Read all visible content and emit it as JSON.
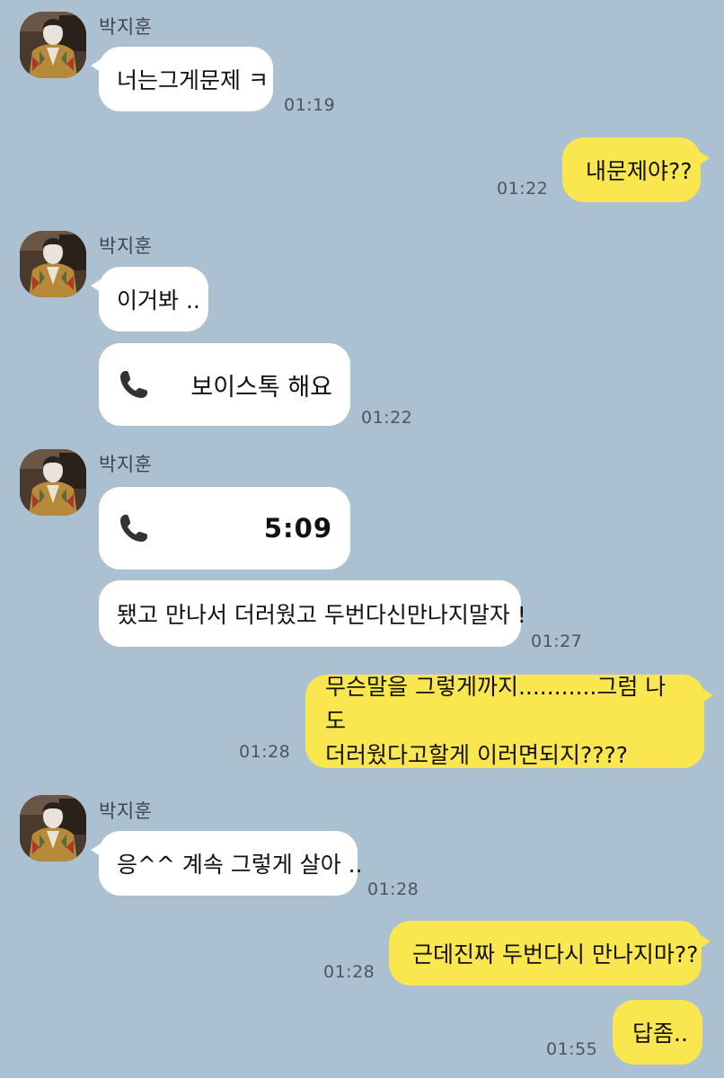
{
  "sender_name": "박지훈",
  "messages": [
    {
      "text": "너는그게문제 ㅋ",
      "time": "01:19"
    },
    {
      "text": "내문제야??",
      "time": "01:22"
    },
    {
      "text": "이거봐 ..",
      "time": ""
    },
    {
      "call_label": "보이스톡 해요",
      "time": "01:22"
    },
    {
      "call_label": "5:09",
      "time": ""
    },
    {
      "text": "됐고 만나서 더러웠고 두번다신만나지말자 !",
      "time": "01:27"
    },
    {
      "line1": "무슨말을 그렇게까지...........그럼 나도",
      "line2": "더러웠다고할게 이러면되지????",
      "time": "01:28"
    },
    {
      "text": "응^^ 계속 그렇게 살아 ..",
      "time": "01:28"
    },
    {
      "text": "근데진짜 두번다시 만나지마??",
      "time": "01:28"
    },
    {
      "text": "답좀..",
      "time": "01:55"
    }
  ],
  "colors": {
    "background": "#abc1d1",
    "incoming": "#ffffff",
    "outgoing": "#fae74f"
  },
  "icons": {
    "call": "phone-icon",
    "avatar": "avatar"
  }
}
